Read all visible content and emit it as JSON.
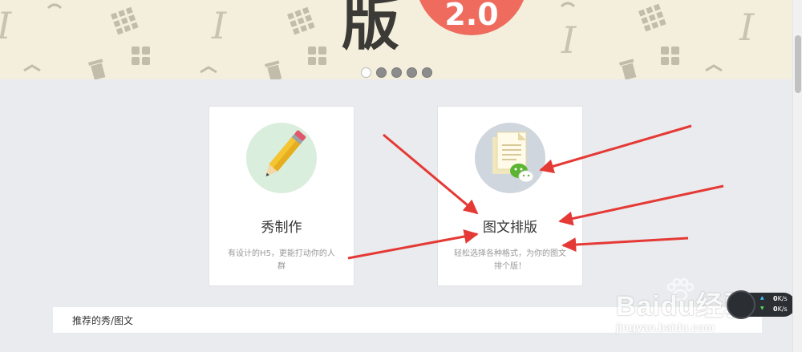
{
  "banner": {
    "title": "版",
    "badge": "2.0",
    "dots": [
      true,
      false,
      false,
      false,
      false
    ]
  },
  "cards": [
    {
      "id": "edit",
      "icon": "pencil-icon",
      "title": "秀制作",
      "desc": "有设计的H5，更能打动你的人群"
    },
    {
      "id": "layout",
      "icon": "document-wechat-icon",
      "title": "图文排版",
      "desc": "轻松选择各种格式，为你的图文排个版！"
    }
  ],
  "recommended": {
    "label": "推荐的秀/图文"
  },
  "speed_widget": {
    "upload": "0",
    "download": "0",
    "unit": "K/s"
  },
  "watermark": {
    "logo": "Baidu经验",
    "url": "jingyan.baidu.com"
  },
  "colors": {
    "banner_bg": "#f3efdc",
    "badge": "#ee6b5e",
    "page_bg": "#e9ebee",
    "arrow": "#e53935"
  }
}
